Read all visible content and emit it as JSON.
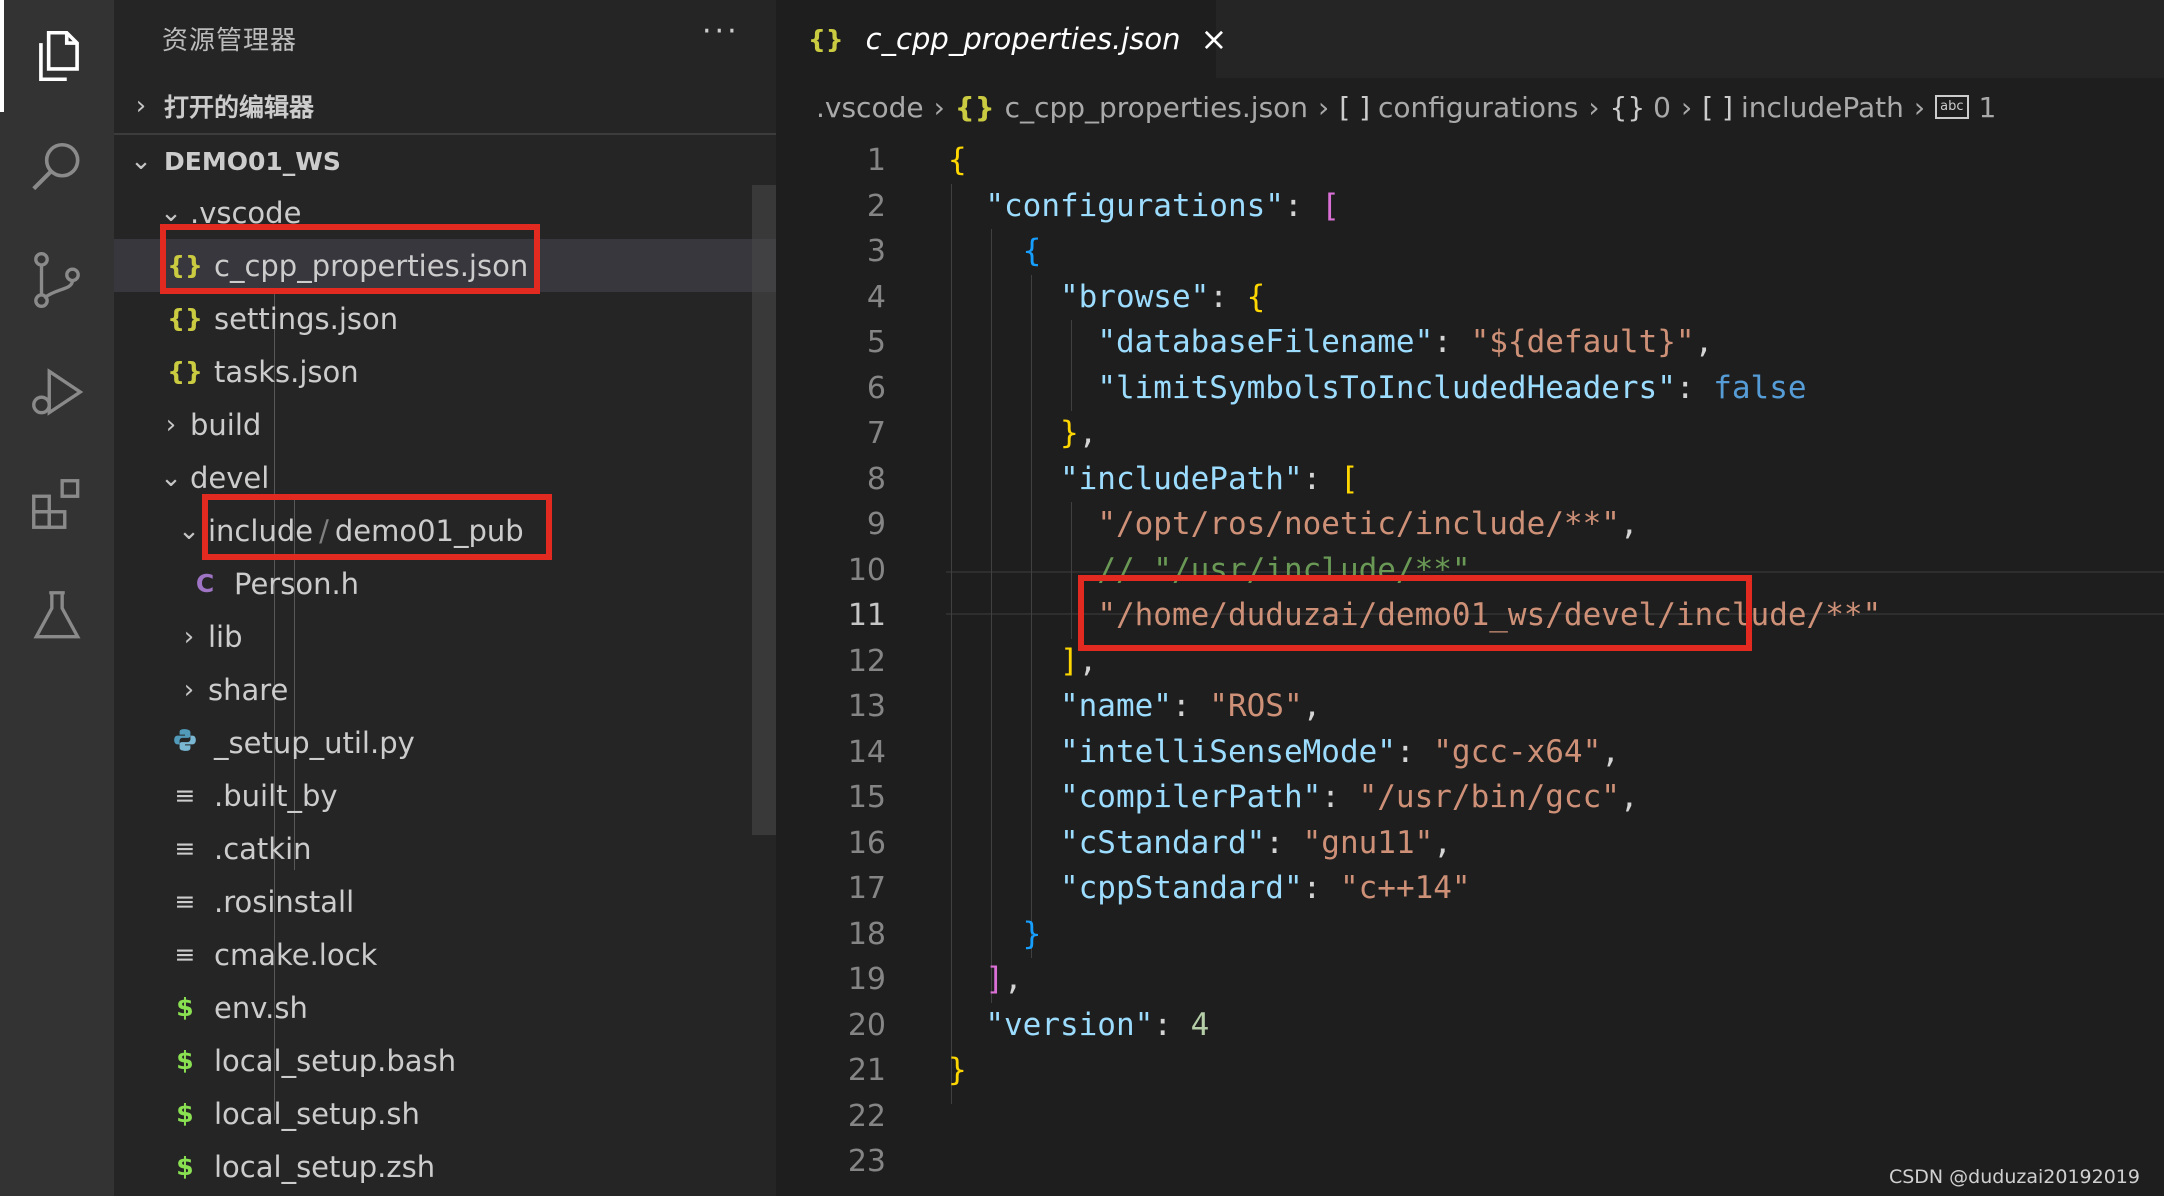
{
  "explorer": {
    "title": "资源管理器",
    "more": "···",
    "open_editors": "打开的编辑器",
    "workspace": "DEMO01_WS",
    "tree": [
      {
        "label": ".vscode",
        "icon": "chevron-down"
      },
      {
        "label": "c_cpp_properties.json",
        "icon": "{}"
      },
      {
        "label": "settings.json",
        "icon": "{}"
      },
      {
        "label": "tasks.json",
        "icon": "{}"
      },
      {
        "label": "build",
        "icon": "chevron-right"
      },
      {
        "label": "devel",
        "icon": "chevron-down"
      },
      {
        "label": "include",
        "label2": "demo01_pub",
        "icon": "chevron-down"
      },
      {
        "label": "Person.h",
        "icon": "C"
      },
      {
        "label": "lib",
        "icon": "chevron-right"
      },
      {
        "label": "share",
        "icon": "chevron-right"
      },
      {
        "label": "_setup_util.py",
        "icon": "python"
      },
      {
        "label": ".built_by",
        "icon": "≡"
      },
      {
        "label": ".catkin",
        "icon": "≡"
      },
      {
        "label": ".rosinstall",
        "icon": "≡"
      },
      {
        "label": "cmake.lock",
        "icon": "≡"
      },
      {
        "label": "env.sh",
        "icon": "$"
      },
      {
        "label": "local_setup.bash",
        "icon": "$"
      },
      {
        "label": "local_setup.sh",
        "icon": "$"
      },
      {
        "label": "local_setup.zsh",
        "icon": "$"
      }
    ]
  },
  "tab": {
    "icon": "{}",
    "label": "c_cpp_properties.json",
    "close": "×"
  },
  "breadcrumb": {
    "folder": ".vscode",
    "file_icon": "{}",
    "file": "c_cpp_properties.json",
    "configurations_icon": "[ ]",
    "configurations": "configurations",
    "index_icon": "{}",
    "index": "0",
    "includepath_icon": "[ ]",
    "includepath": "includePath",
    "string_icon": "abc",
    "string_index": "1"
  },
  "line_numbers": [
    "1",
    "2",
    "3",
    "4",
    "5",
    "6",
    "7",
    "8",
    "9",
    "10",
    "11",
    "12",
    "13",
    "14",
    "15",
    "16",
    "17",
    "18",
    "19",
    "20",
    "21",
    "22",
    "23"
  ],
  "code": {
    "l2_key": "\"configurations\"",
    "l4_key": "\"browse\"",
    "l5_key": "\"databaseFilename\"",
    "l5_val": "\"${default}\"",
    "l6_key": "\"limitSymbolsToIncludedHeaders\"",
    "l6_val": "false",
    "l8_key": "\"includePath\"",
    "l9_val": "\"/opt/ros/noetic/include/**\"",
    "l10_comment": "// \"/usr/include/**\"",
    "l11_val": "\"/home/duduzai/demo01_ws/devel/include/**\"",
    "l13_key": "\"name\"",
    "l13_val": "\"ROS\"",
    "l14_key": "\"intelliSenseMode\"",
    "l14_val": "\"gcc-x64\"",
    "l15_key": "\"compilerPath\"",
    "l15_val": "\"/usr/bin/gcc\"",
    "l16_key": "\"cStandard\"",
    "l16_val": "\"gnu11\"",
    "l17_key": "\"cppStandard\"",
    "l17_val": "\"c++14\"",
    "l20_key": "\"version\"",
    "l20_val": "4"
  },
  "watermark": "CSDN @duduzai20192019",
  "colors": {
    "highlight": "#e22a20",
    "json_icon": "#cbcb41",
    "string": "#ce9178",
    "key": "#9cdcfe"
  }
}
